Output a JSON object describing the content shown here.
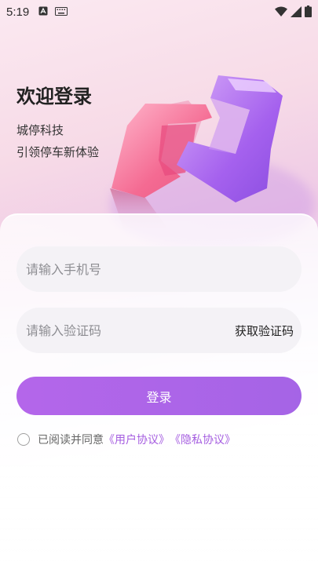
{
  "status_bar": {
    "time": "5:19",
    "left_icons": [
      "text-icon",
      "keyboard-icon"
    ],
    "right_icons": [
      "wifi-icon",
      "signal-icon",
      "battery-icon"
    ]
  },
  "header": {
    "title": "欢迎登录",
    "company": "城停科技",
    "slogan": "引领停车新体验"
  },
  "form": {
    "phone_placeholder": "请输入手机号",
    "code_placeholder": "请输入验证码",
    "get_code_label": "获取验证码",
    "login_label": "登录"
  },
  "agreement": {
    "prefix": "已阅读并同意",
    "user_agreement": "《用户协议》",
    "privacy_agreement": "《隐私协议》"
  },
  "colors": {
    "accent": "#a564e6",
    "link": "#a55de0",
    "field_bg": "#f4f2f6"
  }
}
